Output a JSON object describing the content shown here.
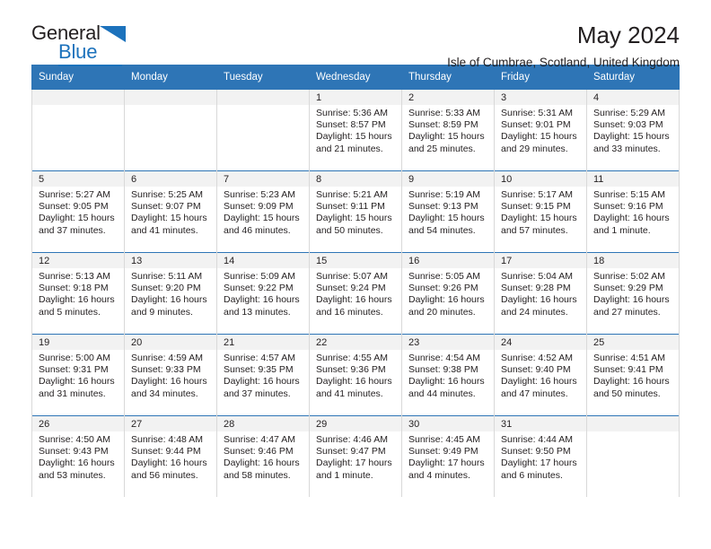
{
  "brand": {
    "name_part1": "General",
    "name_part2": "Blue"
  },
  "header": {
    "title": "May 2024",
    "subtitle": "Isle of Cumbrae, Scotland, United Kingdom"
  },
  "colors": {
    "header_blue": "#2e75b6",
    "brand_blue": "#1c72bc",
    "date_band": "#f2f2f2",
    "text": "#231f20"
  },
  "weekdays": [
    "Sunday",
    "Monday",
    "Tuesday",
    "Wednesday",
    "Thursday",
    "Friday",
    "Saturday"
  ],
  "weeks": [
    [
      {
        "date": "",
        "empty": true
      },
      {
        "date": "",
        "empty": true
      },
      {
        "date": "",
        "empty": true
      },
      {
        "date": "1",
        "sunrise": "Sunrise: 5:36 AM",
        "sunset": "Sunset: 8:57 PM",
        "daylight1": "Daylight: 15 hours",
        "daylight2": "and 21 minutes."
      },
      {
        "date": "2",
        "sunrise": "Sunrise: 5:33 AM",
        "sunset": "Sunset: 8:59 PM",
        "daylight1": "Daylight: 15 hours",
        "daylight2": "and 25 minutes."
      },
      {
        "date": "3",
        "sunrise": "Sunrise: 5:31 AM",
        "sunset": "Sunset: 9:01 PM",
        "daylight1": "Daylight: 15 hours",
        "daylight2": "and 29 minutes."
      },
      {
        "date": "4",
        "sunrise": "Sunrise: 5:29 AM",
        "sunset": "Sunset: 9:03 PM",
        "daylight1": "Daylight: 15 hours",
        "daylight2": "and 33 minutes."
      }
    ],
    [
      {
        "date": "5",
        "sunrise": "Sunrise: 5:27 AM",
        "sunset": "Sunset: 9:05 PM",
        "daylight1": "Daylight: 15 hours",
        "daylight2": "and 37 minutes."
      },
      {
        "date": "6",
        "sunrise": "Sunrise: 5:25 AM",
        "sunset": "Sunset: 9:07 PM",
        "daylight1": "Daylight: 15 hours",
        "daylight2": "and 41 minutes."
      },
      {
        "date": "7",
        "sunrise": "Sunrise: 5:23 AM",
        "sunset": "Sunset: 9:09 PM",
        "daylight1": "Daylight: 15 hours",
        "daylight2": "and 46 minutes."
      },
      {
        "date": "8",
        "sunrise": "Sunrise: 5:21 AM",
        "sunset": "Sunset: 9:11 PM",
        "daylight1": "Daylight: 15 hours",
        "daylight2": "and 50 minutes."
      },
      {
        "date": "9",
        "sunrise": "Sunrise: 5:19 AM",
        "sunset": "Sunset: 9:13 PM",
        "daylight1": "Daylight: 15 hours",
        "daylight2": "and 54 minutes."
      },
      {
        "date": "10",
        "sunrise": "Sunrise: 5:17 AM",
        "sunset": "Sunset: 9:15 PM",
        "daylight1": "Daylight: 15 hours",
        "daylight2": "and 57 minutes."
      },
      {
        "date": "11",
        "sunrise": "Sunrise: 5:15 AM",
        "sunset": "Sunset: 9:16 PM",
        "daylight1": "Daylight: 16 hours",
        "daylight2": "and 1 minute."
      }
    ],
    [
      {
        "date": "12",
        "sunrise": "Sunrise: 5:13 AM",
        "sunset": "Sunset: 9:18 PM",
        "daylight1": "Daylight: 16 hours",
        "daylight2": "and 5 minutes."
      },
      {
        "date": "13",
        "sunrise": "Sunrise: 5:11 AM",
        "sunset": "Sunset: 9:20 PM",
        "daylight1": "Daylight: 16 hours",
        "daylight2": "and 9 minutes."
      },
      {
        "date": "14",
        "sunrise": "Sunrise: 5:09 AM",
        "sunset": "Sunset: 9:22 PM",
        "daylight1": "Daylight: 16 hours",
        "daylight2": "and 13 minutes."
      },
      {
        "date": "15",
        "sunrise": "Sunrise: 5:07 AM",
        "sunset": "Sunset: 9:24 PM",
        "daylight1": "Daylight: 16 hours",
        "daylight2": "and 16 minutes."
      },
      {
        "date": "16",
        "sunrise": "Sunrise: 5:05 AM",
        "sunset": "Sunset: 9:26 PM",
        "daylight1": "Daylight: 16 hours",
        "daylight2": "and 20 minutes."
      },
      {
        "date": "17",
        "sunrise": "Sunrise: 5:04 AM",
        "sunset": "Sunset: 9:28 PM",
        "daylight1": "Daylight: 16 hours",
        "daylight2": "and 24 minutes."
      },
      {
        "date": "18",
        "sunrise": "Sunrise: 5:02 AM",
        "sunset": "Sunset: 9:29 PM",
        "daylight1": "Daylight: 16 hours",
        "daylight2": "and 27 minutes."
      }
    ],
    [
      {
        "date": "19",
        "sunrise": "Sunrise: 5:00 AM",
        "sunset": "Sunset: 9:31 PM",
        "daylight1": "Daylight: 16 hours",
        "daylight2": "and 31 minutes."
      },
      {
        "date": "20",
        "sunrise": "Sunrise: 4:59 AM",
        "sunset": "Sunset: 9:33 PM",
        "daylight1": "Daylight: 16 hours",
        "daylight2": "and 34 minutes."
      },
      {
        "date": "21",
        "sunrise": "Sunrise: 4:57 AM",
        "sunset": "Sunset: 9:35 PM",
        "daylight1": "Daylight: 16 hours",
        "daylight2": "and 37 minutes."
      },
      {
        "date": "22",
        "sunrise": "Sunrise: 4:55 AM",
        "sunset": "Sunset: 9:36 PM",
        "daylight1": "Daylight: 16 hours",
        "daylight2": "and 41 minutes."
      },
      {
        "date": "23",
        "sunrise": "Sunrise: 4:54 AM",
        "sunset": "Sunset: 9:38 PM",
        "daylight1": "Daylight: 16 hours",
        "daylight2": "and 44 minutes."
      },
      {
        "date": "24",
        "sunrise": "Sunrise: 4:52 AM",
        "sunset": "Sunset: 9:40 PM",
        "daylight1": "Daylight: 16 hours",
        "daylight2": "and 47 minutes."
      },
      {
        "date": "25",
        "sunrise": "Sunrise: 4:51 AM",
        "sunset": "Sunset: 9:41 PM",
        "daylight1": "Daylight: 16 hours",
        "daylight2": "and 50 minutes."
      }
    ],
    [
      {
        "date": "26",
        "sunrise": "Sunrise: 4:50 AM",
        "sunset": "Sunset: 9:43 PM",
        "daylight1": "Daylight: 16 hours",
        "daylight2": "and 53 minutes."
      },
      {
        "date": "27",
        "sunrise": "Sunrise: 4:48 AM",
        "sunset": "Sunset: 9:44 PM",
        "daylight1": "Daylight: 16 hours",
        "daylight2": "and 56 minutes."
      },
      {
        "date": "28",
        "sunrise": "Sunrise: 4:47 AM",
        "sunset": "Sunset: 9:46 PM",
        "daylight1": "Daylight: 16 hours",
        "daylight2": "and 58 minutes."
      },
      {
        "date": "29",
        "sunrise": "Sunrise: 4:46 AM",
        "sunset": "Sunset: 9:47 PM",
        "daylight1": "Daylight: 17 hours",
        "daylight2": "and 1 minute."
      },
      {
        "date": "30",
        "sunrise": "Sunrise: 4:45 AM",
        "sunset": "Sunset: 9:49 PM",
        "daylight1": "Daylight: 17 hours",
        "daylight2": "and 4 minutes."
      },
      {
        "date": "31",
        "sunrise": "Sunrise: 4:44 AM",
        "sunset": "Sunset: 9:50 PM",
        "daylight1": "Daylight: 17 hours",
        "daylight2": "and 6 minutes."
      },
      {
        "date": "",
        "empty": true
      }
    ]
  ]
}
